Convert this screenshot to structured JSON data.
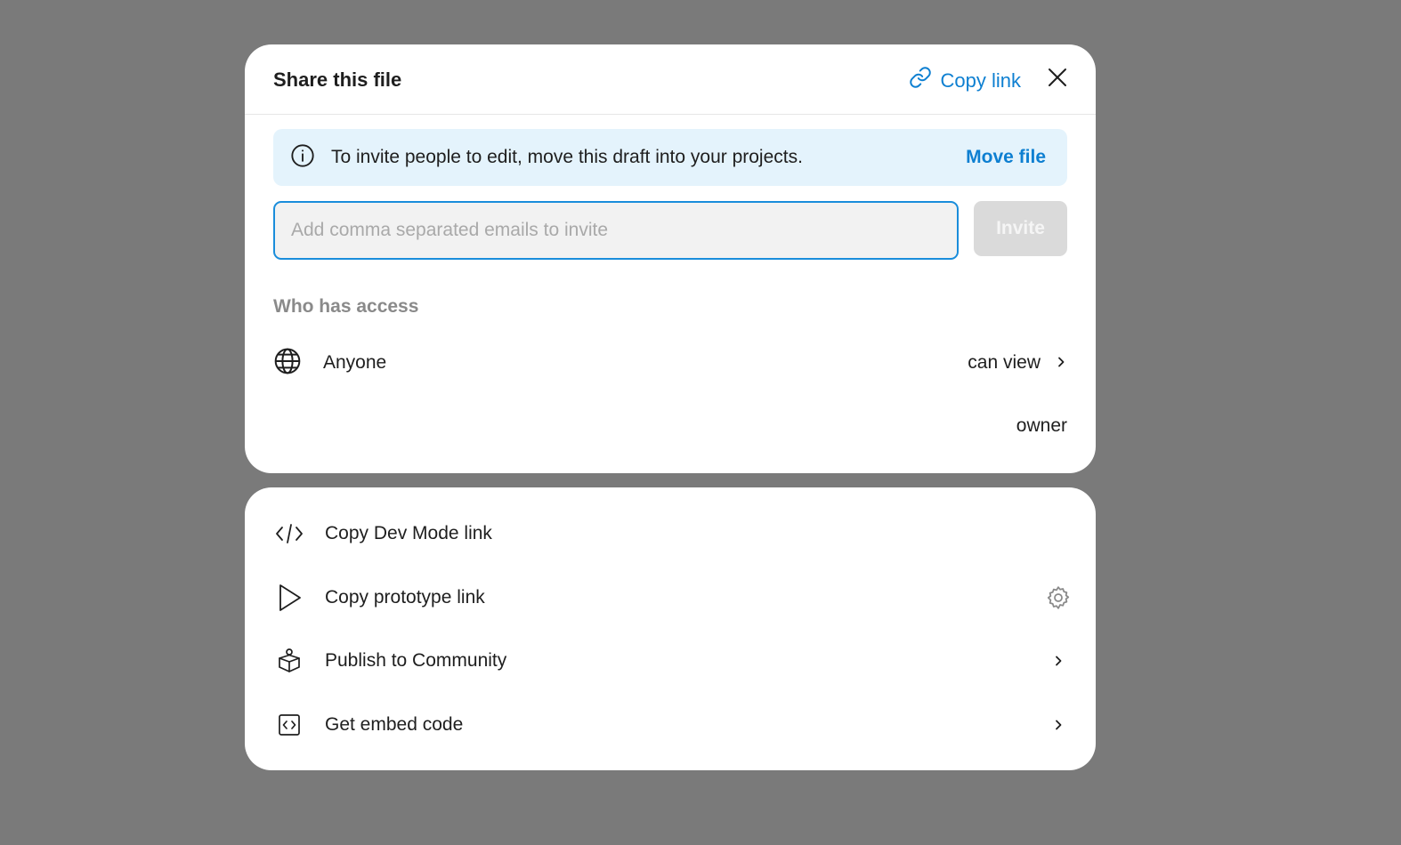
{
  "dialog": {
    "title": "Share this file",
    "copy_link_label": "Copy link"
  },
  "banner": {
    "message": "To invite people to edit, move this draft into your projects.",
    "action_label": "Move file"
  },
  "invite": {
    "placeholder": "Add comma separated emails to invite",
    "value": "",
    "button_label": "Invite"
  },
  "access": {
    "section_label": "Who has access",
    "rows": [
      {
        "name": "Anyone",
        "permission": "can view",
        "icon": "globe-icon"
      }
    ],
    "owner_label": "owner"
  },
  "actions": [
    {
      "label": "Copy Dev Mode link",
      "icon": "code-icon",
      "trailing": ""
    },
    {
      "label": "Copy prototype link",
      "icon": "play-icon",
      "trailing": "gear-icon"
    },
    {
      "label": "Publish to Community",
      "icon": "community-icon",
      "trailing": "chevron-right-icon"
    },
    {
      "label": "Get embed code",
      "icon": "embed-icon",
      "trailing": "chevron-right-icon"
    }
  ],
  "colors": {
    "accent": "#0d7fd1",
    "banner_bg": "#e4f3fc",
    "overlay": "#7a7a7a"
  }
}
